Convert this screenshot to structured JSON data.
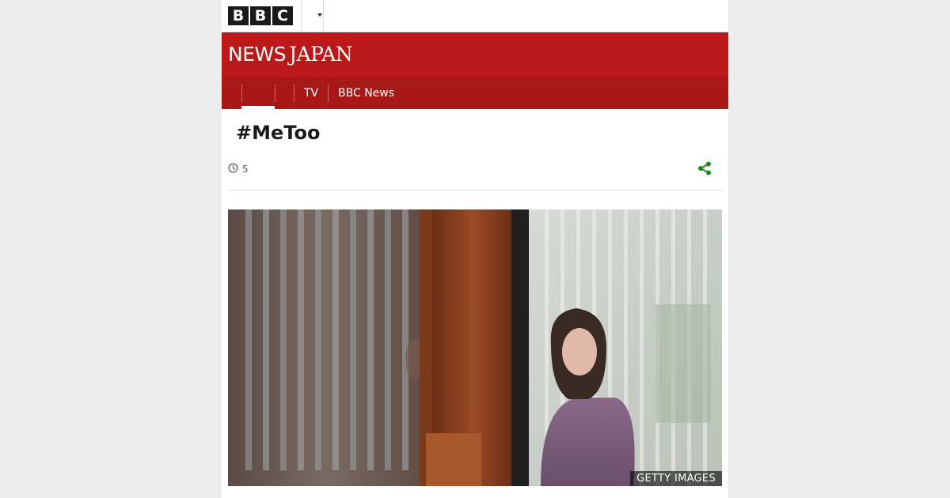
{
  "topbar": {
    "logo_letters": [
      "B",
      "B",
      "C"
    ],
    "more_icon": "chevron-down-icon"
  },
  "masthead": {
    "brand_news": "NEWS",
    "brand_region": "JAPAN",
    "background_color": "#bb1919"
  },
  "nav": {
    "items": [
      {
        "label": "",
        "active": true
      },
      {
        "label": ""
      },
      {
        "label": "TV"
      },
      {
        "label": "BBC News"
      }
    ]
  },
  "article": {
    "headline": "#MeToo",
    "read_time": "5",
    "clock_icon": "clock-icon",
    "share_icon": "share-icon",
    "share_color": "#1a8a1a",
    "image_credit": "GETTY IMAGES"
  }
}
